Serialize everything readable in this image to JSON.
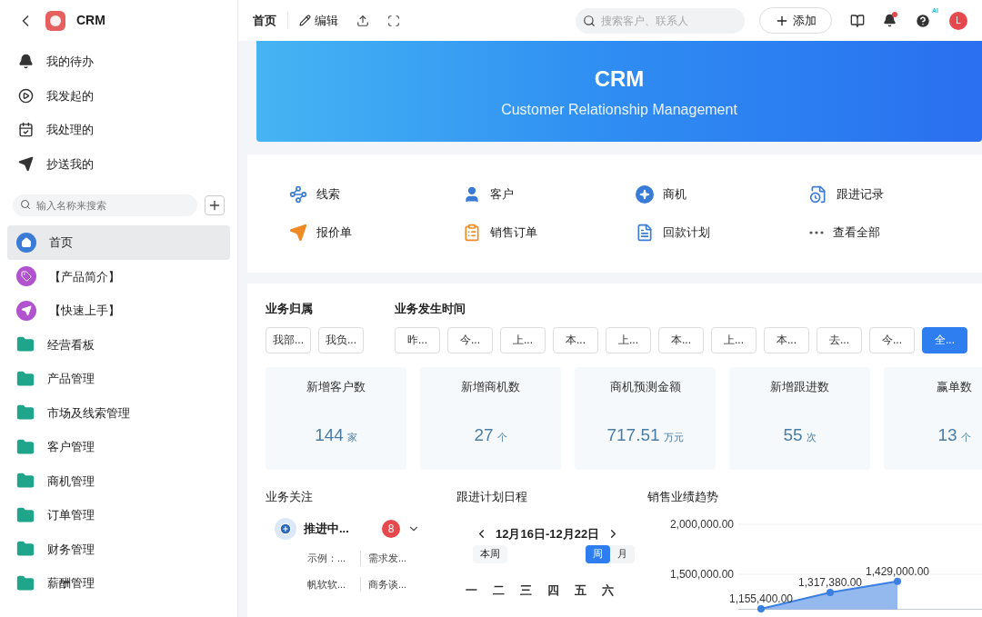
{
  "sidebar": {
    "app_name": "CRM",
    "nav": [
      {
        "label": "我的待办",
        "kind": "bell"
      },
      {
        "label": "我发起的",
        "kind": "play"
      },
      {
        "label": "我处理的",
        "kind": "check"
      },
      {
        "label": "抄送我的",
        "kind": "send"
      }
    ],
    "search": {
      "placeholder": "输入名称来搜索"
    },
    "menu": [
      {
        "label": "首页",
        "kind": "home",
        "selected": true
      },
      {
        "label": "【产品简介】",
        "kind": "tag",
        "selected": false
      },
      {
        "label": "【快速上手】",
        "kind": "send",
        "selected": false
      },
      {
        "label": "经营看板",
        "kind": "folder",
        "selected": false
      },
      {
        "label": "产品管理",
        "kind": "folder",
        "selected": false
      },
      {
        "label": "市场及线索管理",
        "kind": "folder",
        "selected": false
      },
      {
        "label": "客户管理",
        "kind": "folder",
        "selected": false
      },
      {
        "label": "商机管理",
        "kind": "folder",
        "selected": false
      },
      {
        "label": "订单管理",
        "kind": "folder",
        "selected": false
      },
      {
        "label": "财务管理",
        "kind": "folder",
        "selected": false
      },
      {
        "label": "薪酬管理",
        "kind": "folder",
        "selected": false
      }
    ]
  },
  "topbar": {
    "page_title": "首页",
    "edit_button": "编辑",
    "search": {
      "placeholder": "搜索客户、联系人"
    },
    "add_button": "添加",
    "ai_badge": "AI",
    "avatar": "L"
  },
  "banner": {
    "title": "CRM",
    "subtitle": "Customer Relationship Management"
  },
  "quick_links": [
    {
      "label": "线索",
      "kind": "route"
    },
    {
      "label": "客户",
      "kind": "user"
    },
    {
      "label": "商机",
      "kind": "star"
    },
    {
      "label": "跟进记录",
      "kind": "record"
    },
    {
      "label": "报价单",
      "kind": "send"
    },
    {
      "label": "销售订单",
      "kind": "order"
    },
    {
      "label": "回款计划",
      "kind": "plan"
    },
    {
      "label": "查看全部",
      "kind": "more"
    }
  ],
  "filters": {
    "owner": {
      "title": "业务归属",
      "options": [
        {
          "label": "我部...",
          "selected": false
        },
        {
          "label": "我负...",
          "selected": false
        }
      ]
    },
    "time": {
      "title": "业务发生时间",
      "options": [
        {
          "label": "昨...",
          "selected": false
        },
        {
          "label": "今...",
          "selected": false
        },
        {
          "label": "上...",
          "selected": false
        },
        {
          "label": "本...",
          "selected": false
        },
        {
          "label": "上...",
          "selected": false
        },
        {
          "label": "本...",
          "selected": false
        },
        {
          "label": "上...",
          "selected": false
        },
        {
          "label": "本...",
          "selected": false
        },
        {
          "label": "去...",
          "selected": false
        },
        {
          "label": "今...",
          "selected": false
        },
        {
          "label": "全...",
          "selected": true
        }
      ]
    }
  },
  "stats": [
    {
      "title": "新增客户数",
      "value": "144",
      "unit": "家"
    },
    {
      "title": "新增商机数",
      "value": "27",
      "unit": "个"
    },
    {
      "title": "商机预测金额",
      "value": "717.51",
      "unit": "万元"
    },
    {
      "title": "新增跟进数",
      "value": "55",
      "unit": "次"
    },
    {
      "title": "赢单数",
      "value": "13",
      "unit": "个"
    }
  ],
  "focus": {
    "title": "业务关注",
    "group": {
      "label": "推进中...",
      "count": "8",
      "expanded": true
    },
    "rows": [
      [
        "示例：...",
        "需求发..."
      ],
      [
        "帆软软...",
        "商务谈..."
      ]
    ]
  },
  "schedule": {
    "title": "跟进计划日程",
    "range": "12月16日-12月22日",
    "today_button": "本周",
    "views": [
      {
        "label": "周",
        "selected": true
      },
      {
        "label": "月",
        "selected": false
      }
    ],
    "weekdays": [
      "一",
      "二",
      "三",
      "四",
      "五",
      "六"
    ]
  },
  "sales": {
    "title": "销售业绩趋势",
    "chart_data": {
      "type": "area",
      "ylim": [
        1150000,
        2000000
      ],
      "yticks": [
        {
          "value": 1500000,
          "label": "1,500,000.00"
        },
        {
          "value": 2000000,
          "label": "2,000,000.00"
        }
      ],
      "series": [
        {
          "color": "#3b7fe0",
          "values": [
            1155400,
            1317380,
            1429000
          ]
        }
      ],
      "value_labels": [
        "1,155,400.00",
        "1,317,380.00",
        "1,429,000.00"
      ]
    }
  }
}
